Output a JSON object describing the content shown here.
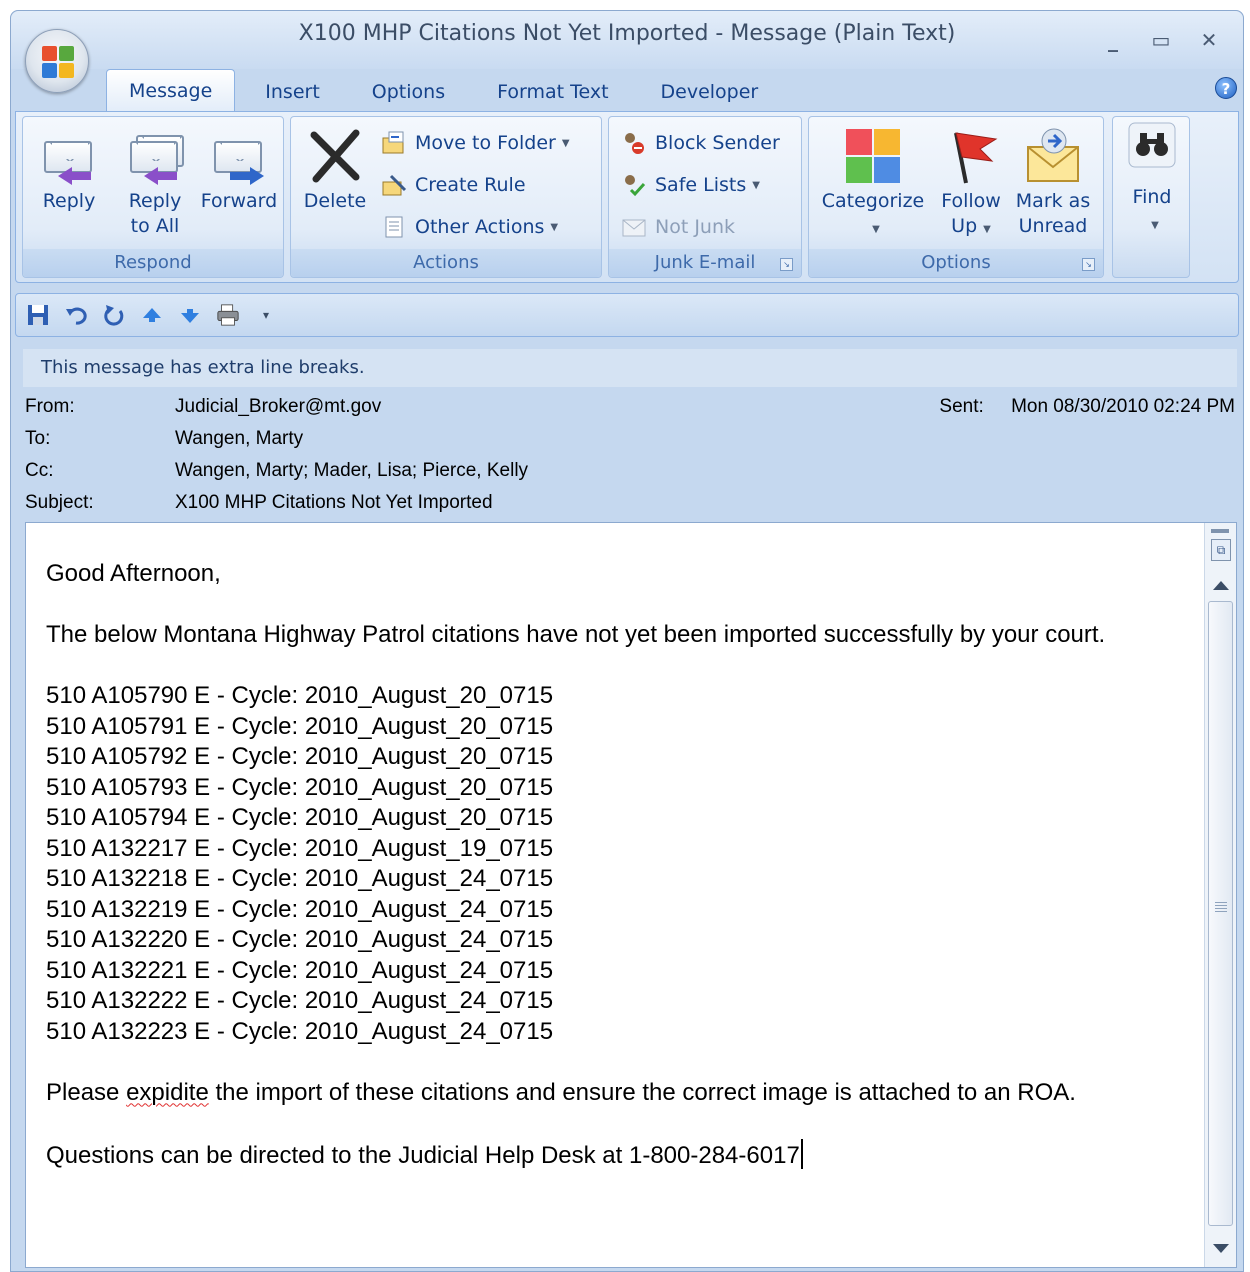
{
  "window": {
    "title": "X100 MHP Citations Not Yet Imported - Message (Plain Text)",
    "controls": {
      "minimize": "_",
      "maximize": "▭",
      "close": "✕"
    }
  },
  "tabs": [
    "Message",
    "Insert",
    "Options",
    "Format Text",
    "Developer"
  ],
  "help_icon": "?",
  "ribbon": {
    "respond": {
      "label": "Respond",
      "reply": "Reply",
      "reply_all_1": "Reply",
      "reply_all_2": "to All",
      "forward": "Forward"
    },
    "actions": {
      "label": "Actions",
      "delete": "Delete",
      "move_to_folder": "Move to Folder",
      "create_rule": "Create Rule",
      "other_actions": "Other Actions"
    },
    "junk": {
      "label": "Junk E-mail",
      "block_sender": "Block Sender",
      "safe_lists": "Safe Lists",
      "not_junk": "Not Junk"
    },
    "options": {
      "label": "Options",
      "categorize": "Categorize",
      "follow_up_1": "Follow",
      "follow_up_2": "Up",
      "mark_unread_1": "Mark as",
      "mark_unread_2": "Unread"
    },
    "find": {
      "label": "Find"
    }
  },
  "quick_access": [
    "save-icon",
    "undo-icon",
    "redo-icon",
    "previous-item-icon",
    "next-item-icon",
    "print-icon",
    "customize-icon"
  ],
  "infobar": "This message has extra line breaks.",
  "header": {
    "from_label": "From:",
    "from": "Judicial_Broker@mt.gov",
    "sent_label": "Sent:",
    "sent": "Mon 08/30/2010 02:24 PM",
    "to_label": "To:",
    "to": "Wangen, Marty",
    "cc_label": "Cc:",
    "cc": "Wangen, Marty; Mader, Lisa; Pierce, Kelly",
    "subject_label": "Subject:",
    "subject": "X100 MHP Citations Not Yet Imported"
  },
  "body": {
    "greeting": "Good Afternoon,",
    "intro": "The below Montana Highway Patrol citations have not yet been imported successfully by your court.",
    "citations": [
      "510 A105790 E - Cycle: 2010_August_20_0715",
      "510 A105791 E - Cycle: 2010_August_20_0715",
      "510 A105792 E - Cycle: 2010_August_20_0715",
      "510 A105793 E - Cycle: 2010_August_20_0715",
      "510 A105794 E - Cycle: 2010_August_20_0715",
      "510 A132217 E - Cycle: 2010_August_19_0715",
      "510 A132218 E - Cycle: 2010_August_24_0715",
      "510 A132219 E - Cycle: 2010_August_24_0715",
      "510 A132220 E - Cycle: 2010_August_24_0715",
      "510 A132221 E - Cycle: 2010_August_24_0715",
      "510 A132222 E - Cycle: 2010_August_24_0715",
      "510 A132223 E - Cycle: 2010_August_24_0715"
    ],
    "please_pre": "Please ",
    "please_misspelled": "expidite",
    "please_post": " the import of these citations and ensure the correct image is attached to an ROA.",
    "questions": "Questions can be directed to the Judicial Help Desk at 1-800-284-6017"
  }
}
